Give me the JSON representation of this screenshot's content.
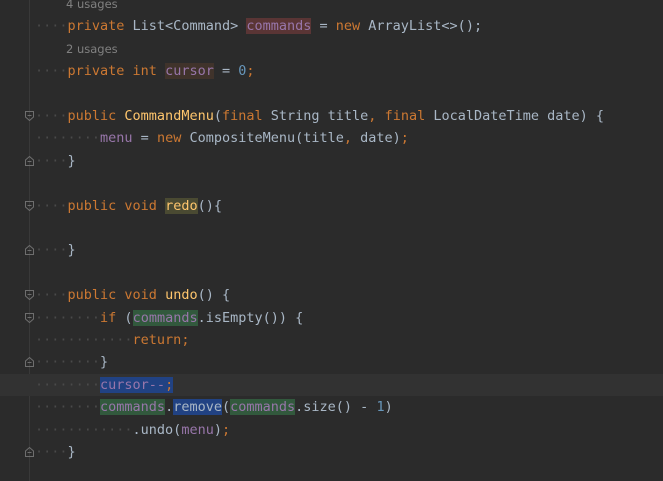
{
  "code_lines": [
    {
      "id": "l0",
      "usages": "4 usages"
    },
    {
      "id": "l1",
      "indent": "····",
      "tokens": [
        {
          "t": "private ",
          "c": "kw"
        },
        {
          "t": "List<Command> ",
          "c": "type"
        },
        {
          "t": "commands",
          "c": "field hl-unused"
        },
        {
          "t": " = ",
          "c": ""
        },
        {
          "t": "new ",
          "c": "kw"
        },
        {
          "t": "ArrayList<>();",
          "c": ""
        }
      ]
    },
    {
      "id": "l2",
      "usages": "2 usages"
    },
    {
      "id": "l3",
      "indent": "····",
      "tokens": [
        {
          "t": "private ",
          "c": "kw"
        },
        {
          "t": "int ",
          "c": "kw"
        },
        {
          "t": "cursor",
          "c": "field hl-write"
        },
        {
          "t": " = ",
          "c": ""
        },
        {
          "t": "0",
          "c": "num"
        },
        {
          "t": ";",
          "c": "kw"
        }
      ]
    },
    {
      "id": "l4"
    },
    {
      "id": "l5",
      "indent": "····",
      "fold": "open",
      "tokens": [
        {
          "t": "public ",
          "c": "kw"
        },
        {
          "t": "CommandMenu",
          "c": "method-decl"
        },
        {
          "t": "(",
          "c": ""
        },
        {
          "t": "final ",
          "c": "kw"
        },
        {
          "t": "String title",
          "c": ""
        },
        {
          "t": ", ",
          "c": "kw"
        },
        {
          "t": "final ",
          "c": "kw"
        },
        {
          "t": "LocalDateTime date) {",
          "c": ""
        }
      ]
    },
    {
      "id": "l6",
      "indent": "········",
      "tokens": [
        {
          "t": "menu",
          "c": "field"
        },
        {
          "t": " = ",
          "c": ""
        },
        {
          "t": "new ",
          "c": "kw"
        },
        {
          "t": "CompositeMenu(title",
          "c": ""
        },
        {
          "t": ", ",
          "c": "kw"
        },
        {
          "t": "date)",
          "c": ""
        },
        {
          "t": ";",
          "c": "kw"
        }
      ]
    },
    {
      "id": "l7",
      "indent": "····",
      "fold": "close",
      "tokens": [
        {
          "t": "}",
          "c": ""
        }
      ]
    },
    {
      "id": "l8"
    },
    {
      "id": "l9",
      "indent": "····",
      "fold": "open",
      "tokens": [
        {
          "t": "public ",
          "c": "kw"
        },
        {
          "t": "void ",
          "c": "kw"
        },
        {
          "t": "redo",
          "c": "method hl-olive"
        },
        {
          "t": "(){",
          "c": ""
        }
      ]
    },
    {
      "id": "l10"
    },
    {
      "id": "l11",
      "indent": "····",
      "fold": "close",
      "tokens": [
        {
          "t": "}",
          "c": ""
        }
      ]
    },
    {
      "id": "l12"
    },
    {
      "id": "l13",
      "indent": "····",
      "fold": "open",
      "tokens": [
        {
          "t": "public ",
          "c": "kw"
        },
        {
          "t": "void ",
          "c": "kw"
        },
        {
          "t": "undo",
          "c": "method"
        },
        {
          "t": "() {",
          "c": ""
        }
      ]
    },
    {
      "id": "l14",
      "indent": "········",
      "fold": "open",
      "tokens": [
        {
          "t": "if ",
          "c": "kw"
        },
        {
          "t": "(",
          "c": ""
        },
        {
          "t": "commands",
          "c": "field hl-green"
        },
        {
          "t": ".isEmpty()) {",
          "c": ""
        }
      ]
    },
    {
      "id": "l15",
      "indent": "············",
      "tokens": [
        {
          "t": "return;",
          "c": "kw"
        }
      ]
    },
    {
      "id": "l16",
      "indent": "········",
      "fold": "close",
      "tokens": [
        {
          "t": "}",
          "c": ""
        }
      ]
    },
    {
      "id": "l17",
      "indent": "········",
      "current": true,
      "tokens": [
        {
          "t": "cursor--",
          "c": "field sel"
        },
        {
          "t": ";",
          "c": "kw sel"
        }
      ]
    },
    {
      "id": "l18",
      "indent": "········",
      "tokens": [
        {
          "t": "commands",
          "c": "field hl-green"
        },
        {
          "t": ".",
          "c": ""
        },
        {
          "t": "remove",
          "c": "hl-blue"
        },
        {
          "t": "(",
          "c": ""
        },
        {
          "t": "commands",
          "c": "field hl-green"
        },
        {
          "t": ".size() - ",
          "c": ""
        },
        {
          "t": "1",
          "c": "num"
        },
        {
          "t": ")",
          "c": ""
        }
      ]
    },
    {
      "id": "l19",
      "indent": "············",
      "tokens": [
        {
          "t": ".undo(",
          "c": ""
        },
        {
          "t": "menu",
          "c": "field"
        },
        {
          "t": ")",
          "c": ""
        },
        {
          "t": ";",
          "c": "kw"
        }
      ]
    },
    {
      "id": "l20",
      "indent": "····",
      "fold": "close",
      "tokens": [
        {
          "t": "}",
          "c": ""
        }
      ]
    }
  ],
  "theme": {
    "background": "#2b2b2b",
    "keyword": "#cc7832",
    "field": "#9876aa",
    "method": "#ffc66d",
    "number": "#6897bb",
    "text": "#a9b7c6"
  }
}
